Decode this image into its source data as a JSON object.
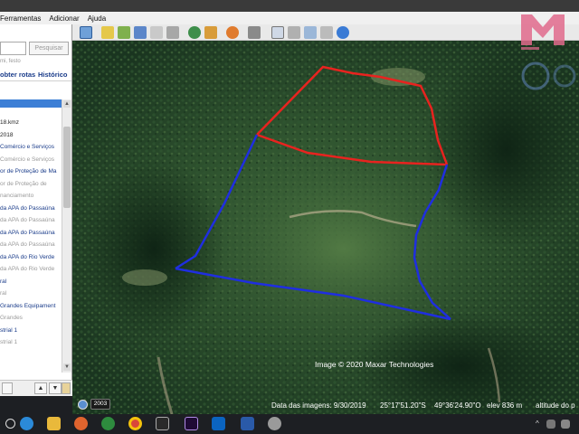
{
  "menu": {
    "items": [
      "Ferramentas",
      "Adicionar",
      "Ajuda"
    ]
  },
  "search": {
    "button_label": "Pesquisar",
    "hint": "mi, festo",
    "get_routes": "obter rotas",
    "history": "Histórico"
  },
  "places": {
    "items": [
      {
        "text": "18.kmz",
        "style": "dark"
      },
      {
        "text": "2018",
        "style": "dark"
      },
      {
        "text": "Comércio e Serviços",
        "style": "blue"
      },
      {
        "text": "Comércio e Serviços",
        "style": "gray"
      },
      {
        "text": "or de Proteção de Ma",
        "style": "blue"
      },
      {
        "text": "or de Proteção de",
        "style": "gray"
      },
      {
        "text": "nanciamento",
        "style": "gray"
      },
      {
        "text": "da APA do Passaúna",
        "style": "blue"
      },
      {
        "text": "da APA do Passaúna",
        "style": "gray"
      },
      {
        "text": "da APA do Passaúna",
        "style": "blue"
      },
      {
        "text": "da APA do Passaúna",
        "style": "gray"
      },
      {
        "text": "da APA do Rio Verde",
        "style": "blue"
      },
      {
        "text": "da APA do Rio Verde",
        "style": "gray"
      },
      {
        "text": "ral",
        "style": "blue"
      },
      {
        "text": "ral",
        "style": "gray"
      },
      {
        "text": "Grandes Equipament",
        "style": "blue"
      },
      {
        "text": "Grandes",
        "style": "gray"
      },
      {
        "text": "strial 1",
        "style": "blue"
      },
      {
        "text": "strial 1",
        "style": "gray"
      }
    ]
  },
  "map": {
    "copyright": "Image © 2020 Maxar Technologies",
    "year_badge": "2003",
    "imagery_date": "Data das imagens: 9/30/2019",
    "latitude": "25°17'51.20\"S",
    "longitude": "49°36'24.90\"O",
    "elevation": "elev   836 m",
    "eye_alt": "altitude do p",
    "red_color": "#e8231f",
    "blue_color": "#1f2ee0"
  },
  "taskbar": {
    "apps": [
      "search-icon",
      "edge-icon",
      "explorer-icon",
      "firefox-icon",
      "money-icon",
      "chrome-icon",
      "chart-app-icon",
      "premiere-icon",
      "outlook-icon",
      "word-icon",
      "earth-icon"
    ],
    "tray_caret": "^"
  }
}
